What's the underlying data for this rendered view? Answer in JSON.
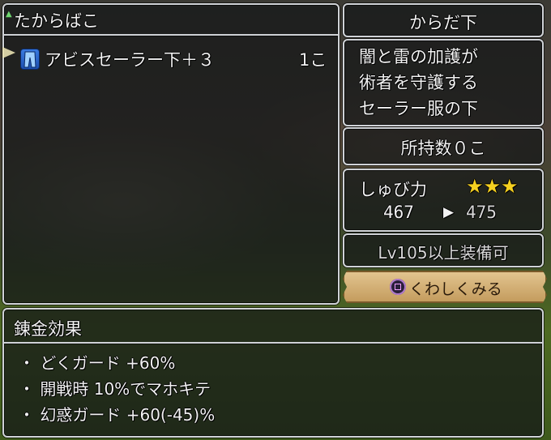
{
  "chest": {
    "title": "たからばこ",
    "item": {
      "name": "アビスセーラー下＋３",
      "qty": "1こ",
      "icon": "pants-icon"
    }
  },
  "detail": {
    "category": "からだ下",
    "description": [
      "闇と雷の加護が",
      "術者を守護する",
      "セーラー服の下"
    ],
    "owned": "所持数０こ",
    "stat_label": "しゅび力",
    "stars": "★★★",
    "stat_before": "467",
    "arrow": "▶",
    "stat_after": "475",
    "level_req": "Lv105以上装備可",
    "look_button": "くわしくみる"
  },
  "alchemy": {
    "title": "錬金効果",
    "effects": [
      "・ どくガード +60%",
      "・ 開戦時 10%でマホキテ",
      "・ 幻惑ガード +60(-45)%"
    ]
  },
  "colors": {
    "accent_gold": "#f5d020",
    "button_bg": "#d4b27a",
    "panel_border": "#cfd2d6"
  }
}
